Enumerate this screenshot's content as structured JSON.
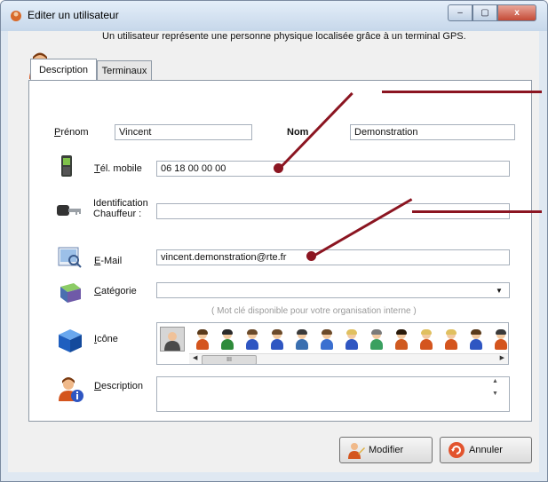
{
  "window": {
    "title": "Editer un utilisateur",
    "controls": {
      "minimize": "–",
      "maximize": "▢",
      "close": "x"
    }
  },
  "intro": "Un utilisateur représente une personne physique localisée grâce à un terminal GPS.",
  "tabs": [
    {
      "label": "Description",
      "active": true
    },
    {
      "label": "Terminaux",
      "active": false
    }
  ],
  "form": {
    "prenom_label": "Prénom",
    "prenom_value": "Vincent",
    "nom_label": "Nom",
    "nom_value": "Demonstration",
    "tel_label": "Tél. mobile",
    "tel_value": "06 18 00 00 00",
    "ident_label_1": "Identification",
    "ident_label_2": "Chauffeur :",
    "ident_value": "",
    "email_label": "E-Mail",
    "email_value": "vincent.demonstration@rte.fr",
    "categorie_label": "Catégorie",
    "categorie_value": "",
    "categorie_hint": "( Mot clé disponible pour votre organisation interne )",
    "icone_label": "Icône",
    "description_label": "Description",
    "description_value": ""
  },
  "icon_strip": {
    "scroll_thumb": "III",
    "icons": [
      {
        "hair": "#5a3a1a",
        "body": "#d4551e"
      },
      {
        "hair": "#2a2a2a",
        "body": "#2e8b3a"
      },
      {
        "hair": "#6b4a2a",
        "body": "#2f56c2"
      },
      {
        "hair": "#6b4a2a",
        "body": "#2f56c2"
      },
      {
        "hair": "#3a3a3a",
        "body": "#3a6fb0"
      },
      {
        "hair": "#6b4a2a",
        "body": "#3a6fd0"
      },
      {
        "hair": "#e0c060",
        "body": "#2f56c2"
      },
      {
        "hair": "#7a7a7a",
        "body": "#3aa060"
      },
      {
        "hair": "#2a1a0a",
        "body": "#d05a20"
      },
      {
        "hair": "#e0c060",
        "body": "#d4551e"
      },
      {
        "hair": "#e0c060",
        "body": "#d4551e"
      },
      {
        "hair": "#5a3a1a",
        "body": "#2f56c2"
      },
      {
        "hair": "#3a3a3a",
        "body": "#d4551e"
      }
    ]
  },
  "buttons": {
    "modifier": "Modifier",
    "annuler": "Annuler"
  },
  "colors": {
    "annotation": "#8b1521",
    "accent": "#2f56c2"
  }
}
